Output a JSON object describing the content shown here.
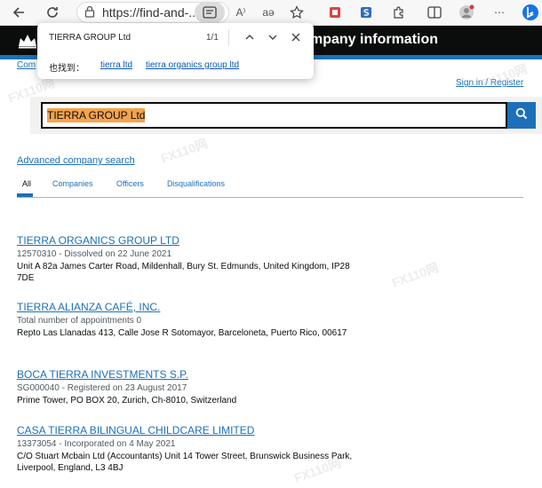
{
  "browser": {
    "url": "https://find-and-...",
    "read_aloud": "A⁾",
    "translate": "aə"
  },
  "header": {
    "service_name": "mpany information"
  },
  "find": {
    "query": "TIERRA GROUP Ltd",
    "count": "1/1",
    "also_label": "也找到：",
    "suggestions": [
      "tierra ltd",
      "tierra organics group ltd"
    ]
  },
  "breadcrumb": "Com",
  "signin": "Sign in / Register",
  "search": {
    "value": "TIERRA GROUP Ltd"
  },
  "advanced_search": "Advanced company search",
  "tabs": [
    "All",
    "Companies",
    "Officers",
    "Disqualifications"
  ],
  "results": [
    {
      "title": "TIERRA ORGANICS GROUP LTD",
      "meta": "12570310 - Dissolved on 22 June 2021",
      "address": "Unit A 82a James Carter Road, Mildenhall, Bury St. Edmunds, United Kingdom, IP28 7DE"
    },
    {
      "title": "TIERRA ALIANZA CAFÉ, INC.",
      "meta": "Total number of appointments 0",
      "address": "Repto Las Llanadas 413, Calle Jose R Sotomayor, Barceloneta, Puerto Rico, 00617"
    },
    {
      "title": "BOCA TIERRA INVESTMENTS S.P.",
      "meta": "SG000040 - Registered on 23 August 2017",
      "address": "Prime Tower, PO BOX 20, Zurich, Ch-8010, Switzerland"
    },
    {
      "title": "CASA TIERRA BILINGUAL CHILDCARE LIMITED",
      "meta": "13373054 - Incorporated on 4 May 2021",
      "address": "C/O Stuart Mcbain Ltd (Accountants) Unit 14 Tower Street, Brunswick Business Park, Liverpool, England, L3 4BJ"
    }
  ],
  "watermark": "FX110网",
  "colors": {
    "link": "#1d70b8",
    "highlight": "#f5a34a",
    "header": "#0b0c0c"
  }
}
